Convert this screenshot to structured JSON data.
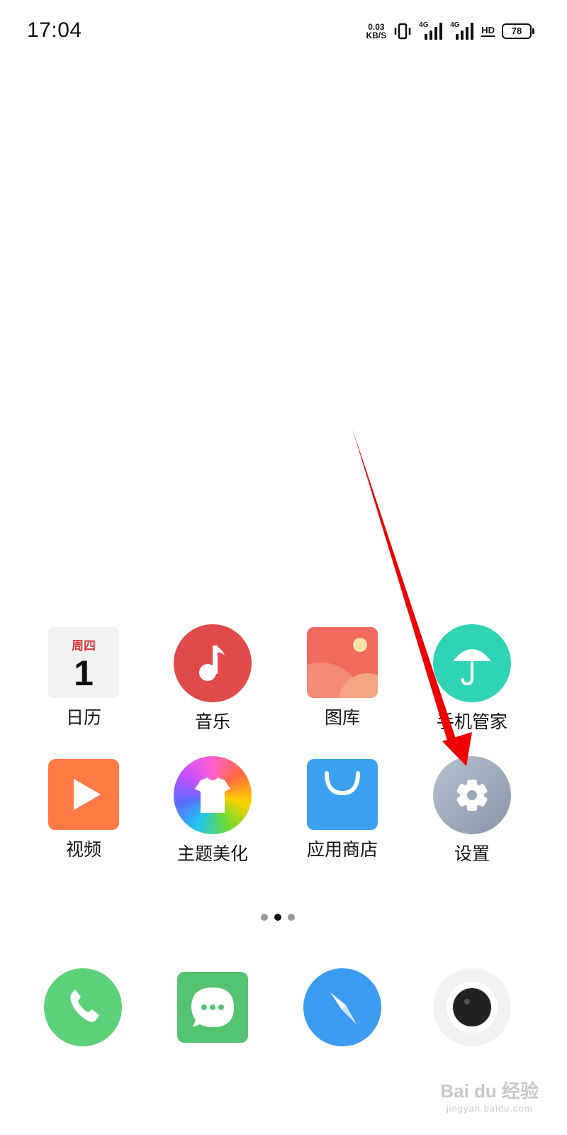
{
  "status_bar": {
    "time": "17:04",
    "net_speed_value": "0.03",
    "net_speed_unit": "KB/S",
    "sim1_label": "4G",
    "sim2_label": "4G",
    "hd_label": "HD",
    "battery_level": "78"
  },
  "apps": [
    {
      "label": "日历",
      "icon": "calendar-icon",
      "weekday": "周四",
      "day": "1"
    },
    {
      "label": "音乐",
      "icon": "music-note-icon"
    },
    {
      "label": "图库",
      "icon": "gallery-icon"
    },
    {
      "label": "手机管家",
      "icon": "umbrella-icon"
    },
    {
      "label": "视频",
      "icon": "play-icon"
    },
    {
      "label": "主题美化",
      "icon": "tshirt-icon"
    },
    {
      "label": "应用商店",
      "icon": "shopping-bag-icon"
    },
    {
      "label": "设置",
      "icon": "gear-icon"
    }
  ],
  "page_indicator": {
    "count": 3,
    "active": 2
  },
  "dock": [
    {
      "icon": "phone-icon"
    },
    {
      "icon": "message-icon"
    },
    {
      "icon": "compass-icon"
    },
    {
      "icon": "camera-icon"
    }
  ],
  "watermark": {
    "brand": "Bai du 经验",
    "url": "jingyan.baidu.com"
  },
  "colors": {
    "calendar_red": "#d9383a",
    "music": "#e14a4a",
    "gallery": "#f06a5e",
    "manager": "#2fd4b5",
    "video": "#ff7a45",
    "store": "#3aa2f0",
    "settings": "#9aa7b8",
    "phone": "#5dd07a",
    "message": "#55c470",
    "browser": "#3b9cf2",
    "arrow": "#ee0000"
  }
}
